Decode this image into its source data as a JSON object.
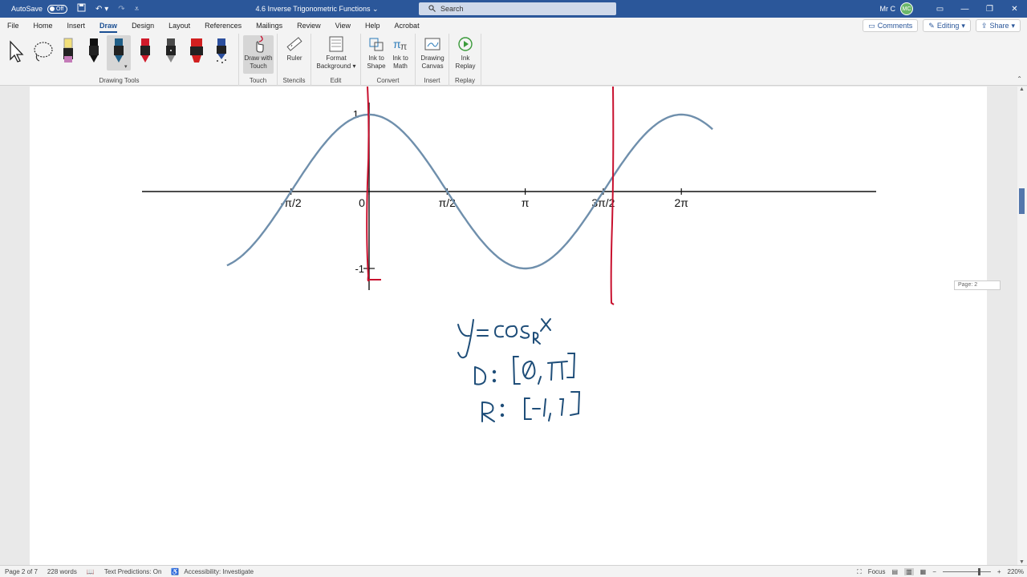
{
  "titlebar": {
    "autosave_label": "AutoSave",
    "autosave_state": "Off",
    "doc_title": "4.6 Inverse Trigonometric Functions",
    "search_placeholder": "Search",
    "user_name": "Mr C",
    "user_initials": "MC"
  },
  "menu": {
    "tabs": [
      "File",
      "Home",
      "Insert",
      "Draw",
      "Design",
      "Layout",
      "References",
      "Mailings",
      "Review",
      "View",
      "Help",
      "Acrobat"
    ],
    "active_tab": "Draw",
    "comments_label": "Comments",
    "editing_label": "Editing",
    "share_label": "Share"
  },
  "ribbon": {
    "groups": {
      "drawing_tools": "Drawing Tools",
      "touch": "Touch",
      "stencils": "Stencils",
      "edit": "Edit",
      "convert": "Convert",
      "insert": "Insert",
      "replay": "Replay"
    },
    "buttons": {
      "draw_with_touch_1": "Draw with",
      "draw_with_touch_2": "Touch",
      "ruler": "Ruler",
      "format_background_1": "Format",
      "format_background_2": "Background",
      "ink_to_shape_1": "Ink to",
      "ink_to_shape_2": "Shape",
      "ink_to_math_1": "Ink to",
      "ink_to_math_2": "Math",
      "drawing_canvas_1": "Drawing",
      "drawing_canvas_2": "Canvas",
      "ink_replay_1": "Ink",
      "ink_replay_2": "Replay"
    },
    "pens": [
      {
        "name": "highlighter-yellow",
        "color": "#f2e07a"
      },
      {
        "name": "pen-black",
        "color": "#111111"
      },
      {
        "name": "pen-blue-selected",
        "color": "#1f5e86"
      },
      {
        "name": "pen-red",
        "color": "#d01a2a"
      },
      {
        "name": "pencil-gray",
        "color": "#4a4a4a"
      },
      {
        "name": "highlighter-red",
        "color": "#d11f1f"
      },
      {
        "name": "galaxy-pen",
        "color": "#2c4f9e"
      }
    ]
  },
  "document": {
    "page_badge": "Page: 2",
    "graph": {
      "tick_labels": [
        "-π/2",
        "0",
        "π/2",
        "π",
        "3π/2",
        "2π"
      ],
      "y_labels": [
        "1",
        "-1"
      ],
      "curve_color": "#6f8fac",
      "ink_red": "#c8102e"
    },
    "handwriting": {
      "line1": "y = cosR x",
      "line2": "D: [0, π]",
      "line3": "R: [-1, 1]",
      "ink_color": "#1f4e79"
    }
  },
  "chart_data": {
    "type": "line",
    "title": "",
    "xlabel": "",
    "ylabel": "",
    "series": [
      {
        "name": "",
        "function": "cos(x)"
      }
    ],
    "x_ticks": [
      "-π/2",
      "0",
      "π/2",
      "π",
      "3π/2",
      "2π"
    ],
    "y_ticks": [
      "1",
      "-1"
    ],
    "xlim": [
      "-π",
      "2π"
    ],
    "ylim": [
      -1,
      1
    ],
    "grid": false
  },
  "statusbar": {
    "page_info": "Page 2 of 7",
    "word_count": "228 words",
    "text_predictions": "Text Predictions: On",
    "accessibility": "Accessibility: Investigate",
    "focus": "Focus",
    "zoom": "220%"
  }
}
